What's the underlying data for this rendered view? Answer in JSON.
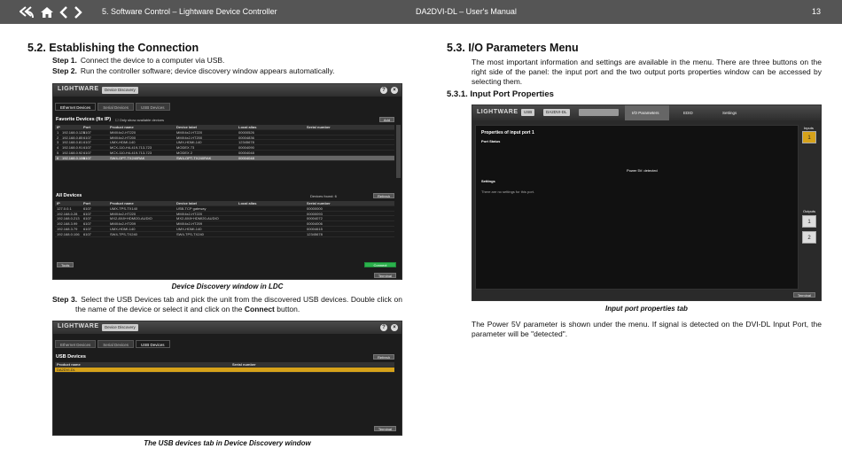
{
  "header": {
    "section": "5. Software Control – Lightware Device Controller",
    "document": "DA2DVI-DL – User's Manual",
    "page": "13",
    "nav_icons": [
      "back-all-icon",
      "home-icon",
      "prev-icon",
      "next-icon"
    ]
  },
  "left": {
    "heading": "5.2.  Establishing the Connection",
    "step1_label": "Step 1.",
    "step1_text": "Connect the device to a computer via USB.",
    "step2_label": "Step 2.",
    "step2_text": "Run the controller software; device discovery window appears automatically.",
    "caption1": "Device Discovery window in LDC",
    "step3_label": "Step 3.",
    "step3_text_a": "Select the USB Devices tab and pick the unit from the discovered USB devices. Double click on the name of the device or select it and click on the ",
    "step3_bold": "Connect",
    "step3_text_b": " button.",
    "caption2": "The USB devices tab in Device Discovery window"
  },
  "right": {
    "heading": "5.3.  I/O Parameters Menu",
    "intro": "The most important information and settings are available in the menu. There are three buttons on the right side of the panel: the input port and the two output ports properties window can be accessed by selecting them.",
    "subheading": "5.3.1.  Input Port Properties",
    "caption": "Input port properties tab",
    "body": "The Power 5V parameter is shown under the menu. If signal is detected on the DVI-DL Input Port, the parameter will be \"detected\"."
  },
  "shot1": {
    "logo": "LIGHTWARE",
    "title_btn": "Device Discovery",
    "tabs": [
      "Ethernet Devices",
      "Serial Devices",
      "USB Devices"
    ],
    "favorites_title": "Favorite Devices (fix IP)",
    "favorites_filter": "Only show available devices",
    "add_label": "Add",
    "headers": [
      "IP",
      "Port",
      "Product name",
      "Device label",
      "Local alias",
      "Serial number"
    ],
    "favorites": [
      [
        "1",
        "192.168.0.123",
        "6107",
        "MMX4x2-HT220",
        "MMX4x2-HT220",
        "00000526"
      ],
      [
        "2",
        "192.168.0.85",
        "6107",
        "MMX4x2-HT200",
        "MMX4x2-HT200",
        "00004836"
      ],
      [
        "3",
        "192.168.0.81",
        "6107",
        "UMX-HDMI-140",
        "UMX-HDMI-140",
        "12345678"
      ],
      [
        "4",
        "192.168.0.91",
        "6107",
        "MCX-110-H4-419-713-723",
        "MODEX 73",
        "00004090"
      ],
      [
        "5",
        "192.168.0.92",
        "6107",
        "MCX-110-H4-419-713-723",
        "MODEX 2",
        "00004048"
      ],
      [
        "6",
        "192.168.0.100",
        "6107",
        "SW4-OPT-TX240RAK",
        "SW4-OPT-TX240RAK",
        "00004048"
      ]
    ],
    "all_title": "All Devices",
    "devices_found": "Devices found: 6",
    "refresh": "Refresh",
    "all_devices": [
      [
        "127.0.0.1",
        "6107",
        "UMX-TPS-TX140",
        "USB-TCP gateway",
        "",
        "00000000"
      ],
      [
        "192.168.0.28",
        "6107",
        "MMX4x2-HT220",
        "MMX4x2-HT220",
        "",
        "00000093"
      ],
      [
        "192.168.0.213",
        "6107",
        "MX2-8X8+HDMI20-AUDIO",
        "MX2-8X8+HDMI20-AUDIO",
        "",
        "00004072"
      ],
      [
        "192.168.3.99",
        "6107",
        "MMX4x2-HT209",
        "MMX4x2-HT209",
        "",
        "00004006"
      ],
      [
        "192.168.3.79",
        "6107",
        "UMX-HDMI-140",
        "UMX-HDMI-140",
        "",
        "00004615"
      ],
      [
        "192.168.0.106",
        "6107",
        "SW4-TPS-TX240",
        "SW4-TPS-TX240",
        "",
        "12345678"
      ]
    ],
    "tools": "Tools",
    "connect": "Connect",
    "terminal": "Terminal"
  },
  "shot2": {
    "logo": "LIGHTWARE",
    "title_btn": "Device Discovery",
    "tabs": [
      "Ethernet Devices",
      "Serial Devices",
      "USB Devices"
    ],
    "panel_title": "USB Devices",
    "refresh": "Refresh",
    "headers": [
      "Product name",
      "Serial number"
    ],
    "rows": [
      [
        "DA2DVI-DL",
        ""
      ]
    ],
    "terminal": "Terminal"
  },
  "shot3": {
    "logo": "LIGHTWARE",
    "usb": "USB",
    "device": "DA2DVI-DL",
    "menus": [
      "I/O Parameters",
      "EDID",
      "Settings"
    ],
    "props_title": "Properties of input port 1",
    "port_status": "Port Status",
    "power_text": "Power 5V: detected",
    "settings_title": "Settings",
    "settings_note": "There are no settings for this port.",
    "inputs_label": "Inputs",
    "outputs_label": "Outputs",
    "input_btn": "1",
    "output_btns": [
      "1",
      "2"
    ],
    "terminal": "Terminal",
    "accent": "#d6a21a"
  }
}
